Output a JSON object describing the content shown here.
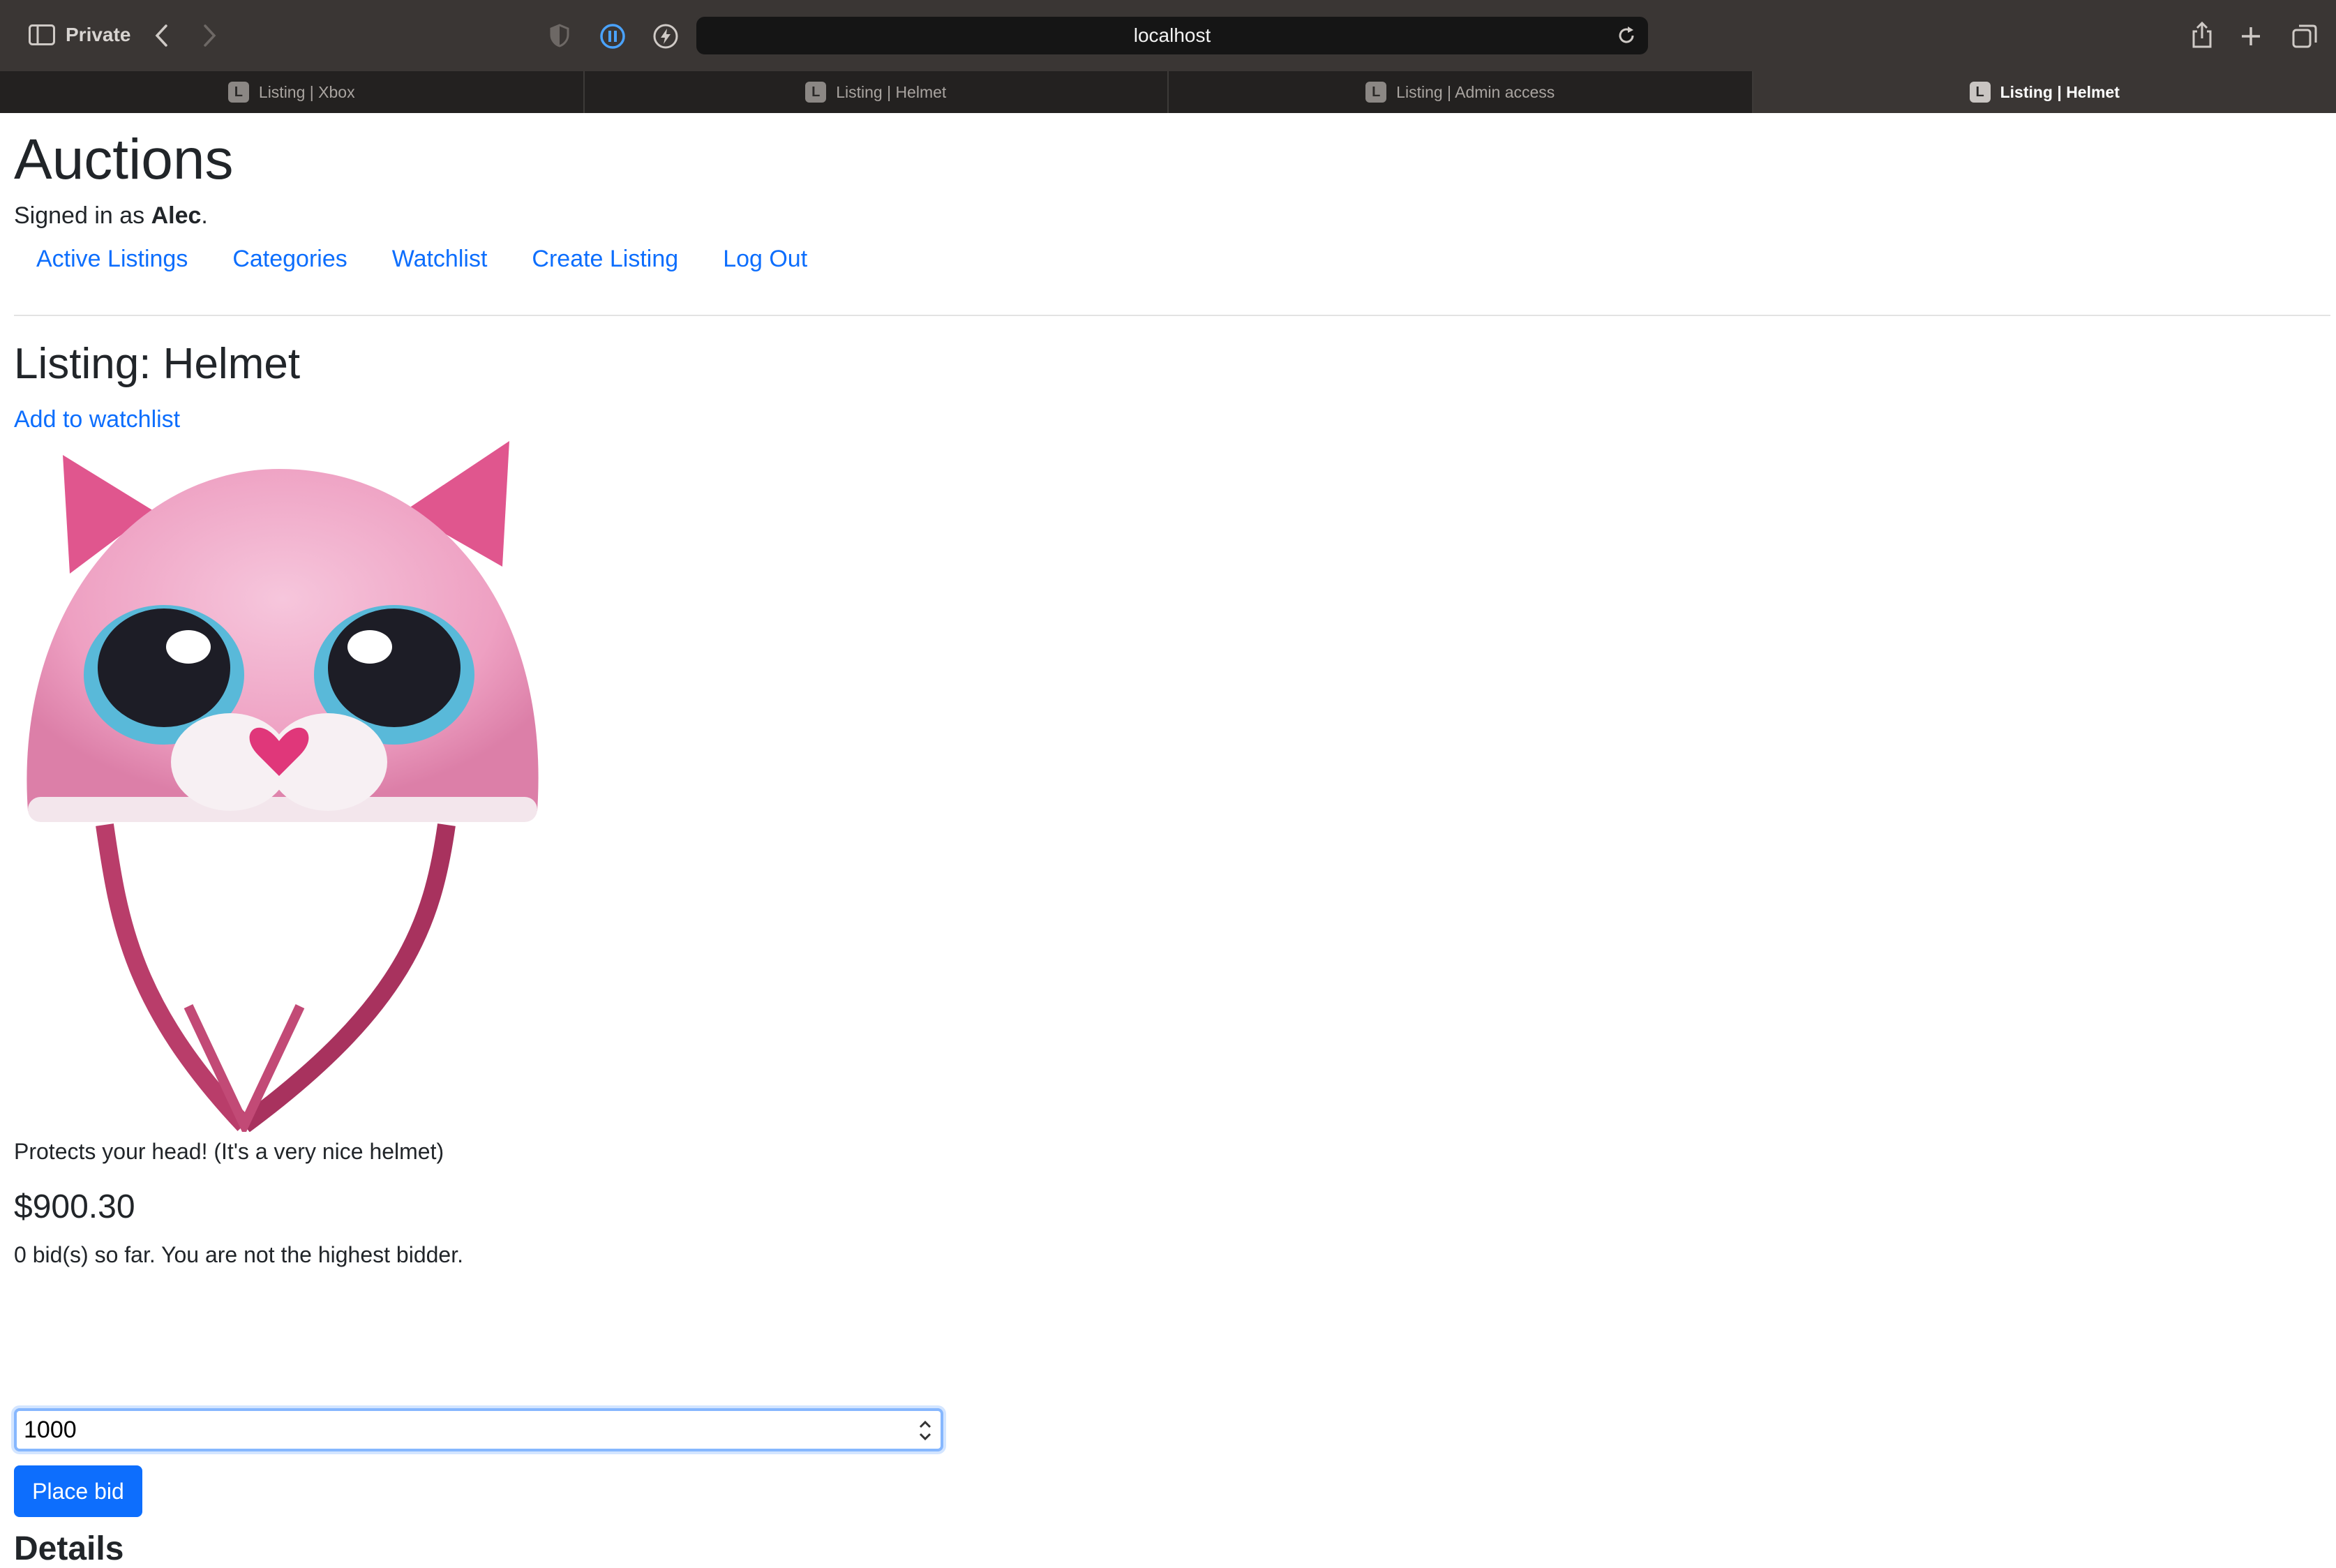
{
  "browser": {
    "private_label": "Private",
    "url": "localhost",
    "tabs": [
      {
        "label": "Listing | Xbox",
        "favicon": "L"
      },
      {
        "label": "Listing | Helmet",
        "favicon": "L"
      },
      {
        "label": "Listing | Admin access",
        "favicon": "L"
      },
      {
        "label": "Listing | Helmet",
        "favicon": "L"
      }
    ]
  },
  "site": {
    "title": "Auctions",
    "signed_in_prefix": "Signed in as ",
    "username": "Alec",
    "signed_in_suffix": ".",
    "nav": [
      "Active Listings",
      "Categories",
      "Watchlist",
      "Create Listing",
      "Log Out"
    ]
  },
  "listing": {
    "title": "Listing: Helmet",
    "watchlist_link": "Add to watchlist",
    "description": "Protects your head! (It's a very nice helmet)",
    "price": "$900.30",
    "bid_status": "0 bid(s) so far. You are not the highest bidder.",
    "bid_value": "1000",
    "place_bid_label": "Place bid",
    "details_heading": "Details"
  },
  "colors": {
    "link": "#0d6efd",
    "button": "#0d6efd",
    "chrome": "#3a3634"
  }
}
